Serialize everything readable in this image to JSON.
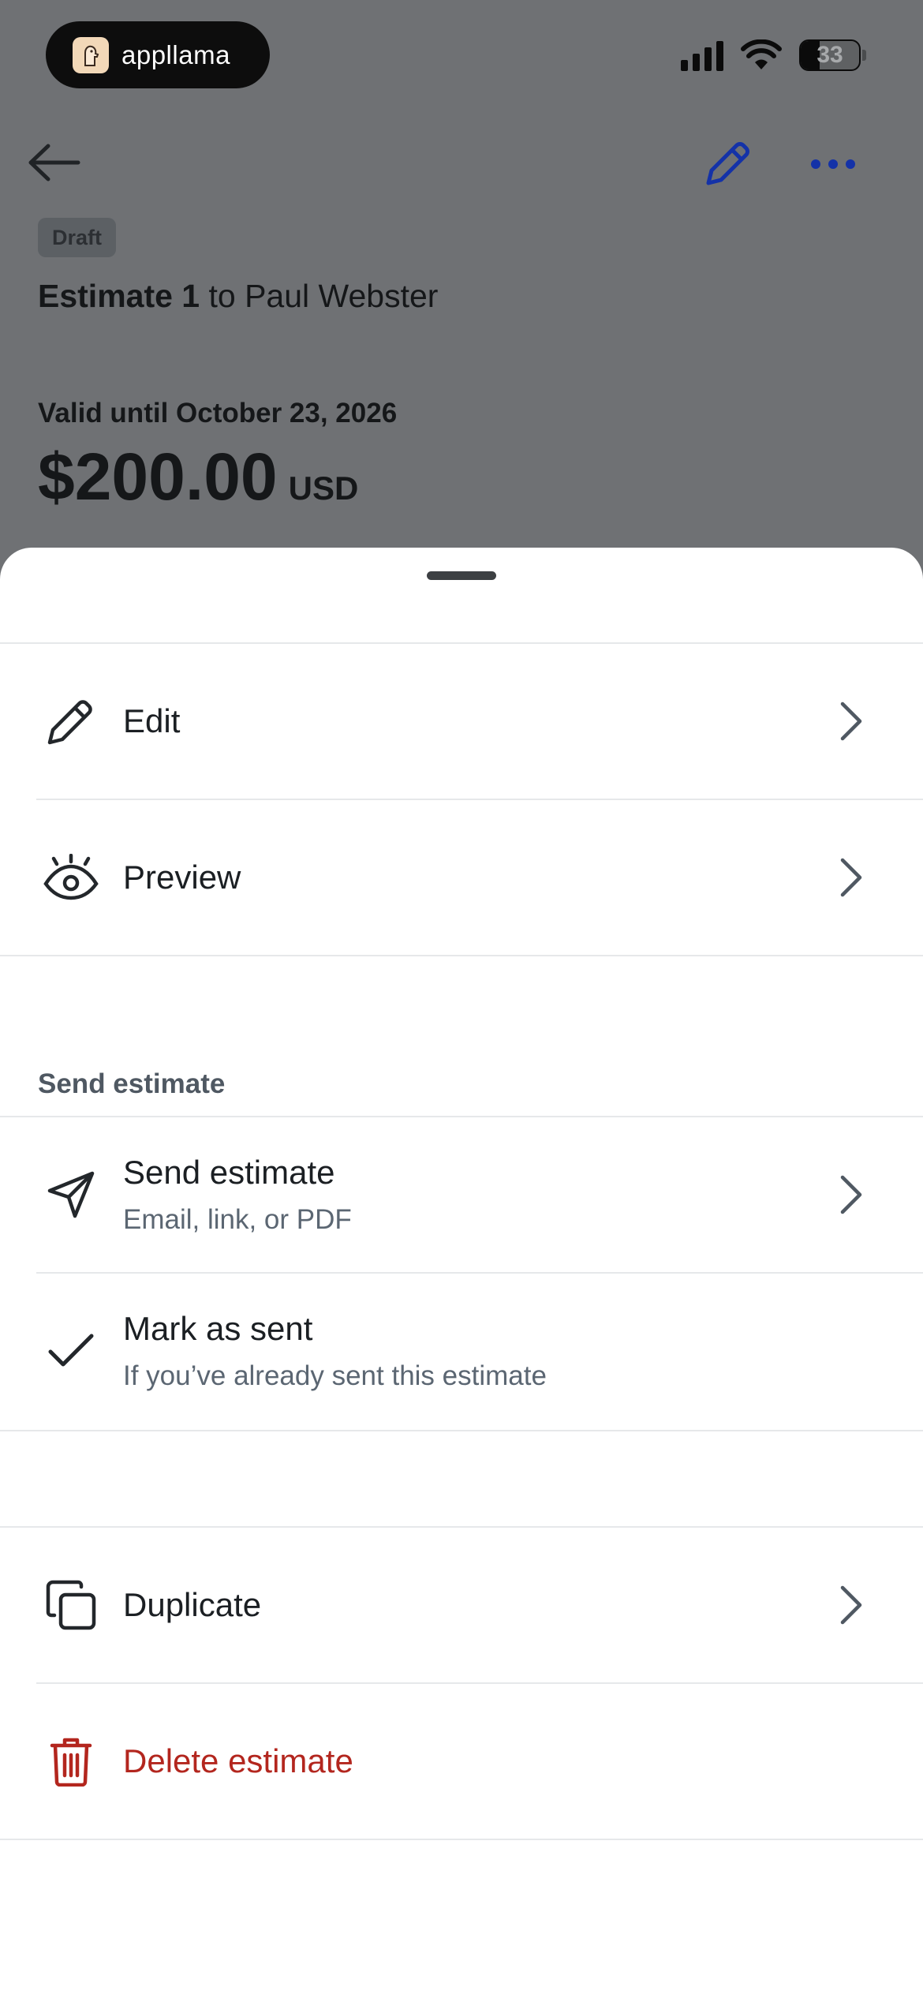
{
  "status_bar": {
    "app_name": "appllama",
    "battery_level": "33"
  },
  "header": {
    "back_icon": "arrow-left-icon",
    "edit_icon": "pencil-icon",
    "more_icon": "more-horizontal-icon",
    "accent_color": "#1432a8"
  },
  "estimate": {
    "status_badge": "Draft",
    "title_bold": "Estimate 1",
    "title_rest": " to Paul Webster",
    "valid_until": "Valid until October 23, 2026",
    "amount": "$200.00",
    "currency": "USD"
  },
  "sheet": {
    "items": [
      {
        "icon": "pencil-icon",
        "label": "Edit"
      },
      {
        "icon": "eye-icon",
        "label": "Preview"
      }
    ],
    "send_section": {
      "title": "Send estimate",
      "items": [
        {
          "icon": "send-icon",
          "label": "Send estimate",
          "subtitle": "Email, link, or PDF"
        },
        {
          "icon": "check-icon",
          "label": "Mark as sent",
          "subtitle": "If you’ve already sent this estimate"
        }
      ]
    },
    "more_items": [
      {
        "icon": "duplicate-icon",
        "label": "Duplicate"
      },
      {
        "icon": "trash-icon",
        "label": "Delete estimate",
        "color": "#b3261e"
      }
    ]
  }
}
